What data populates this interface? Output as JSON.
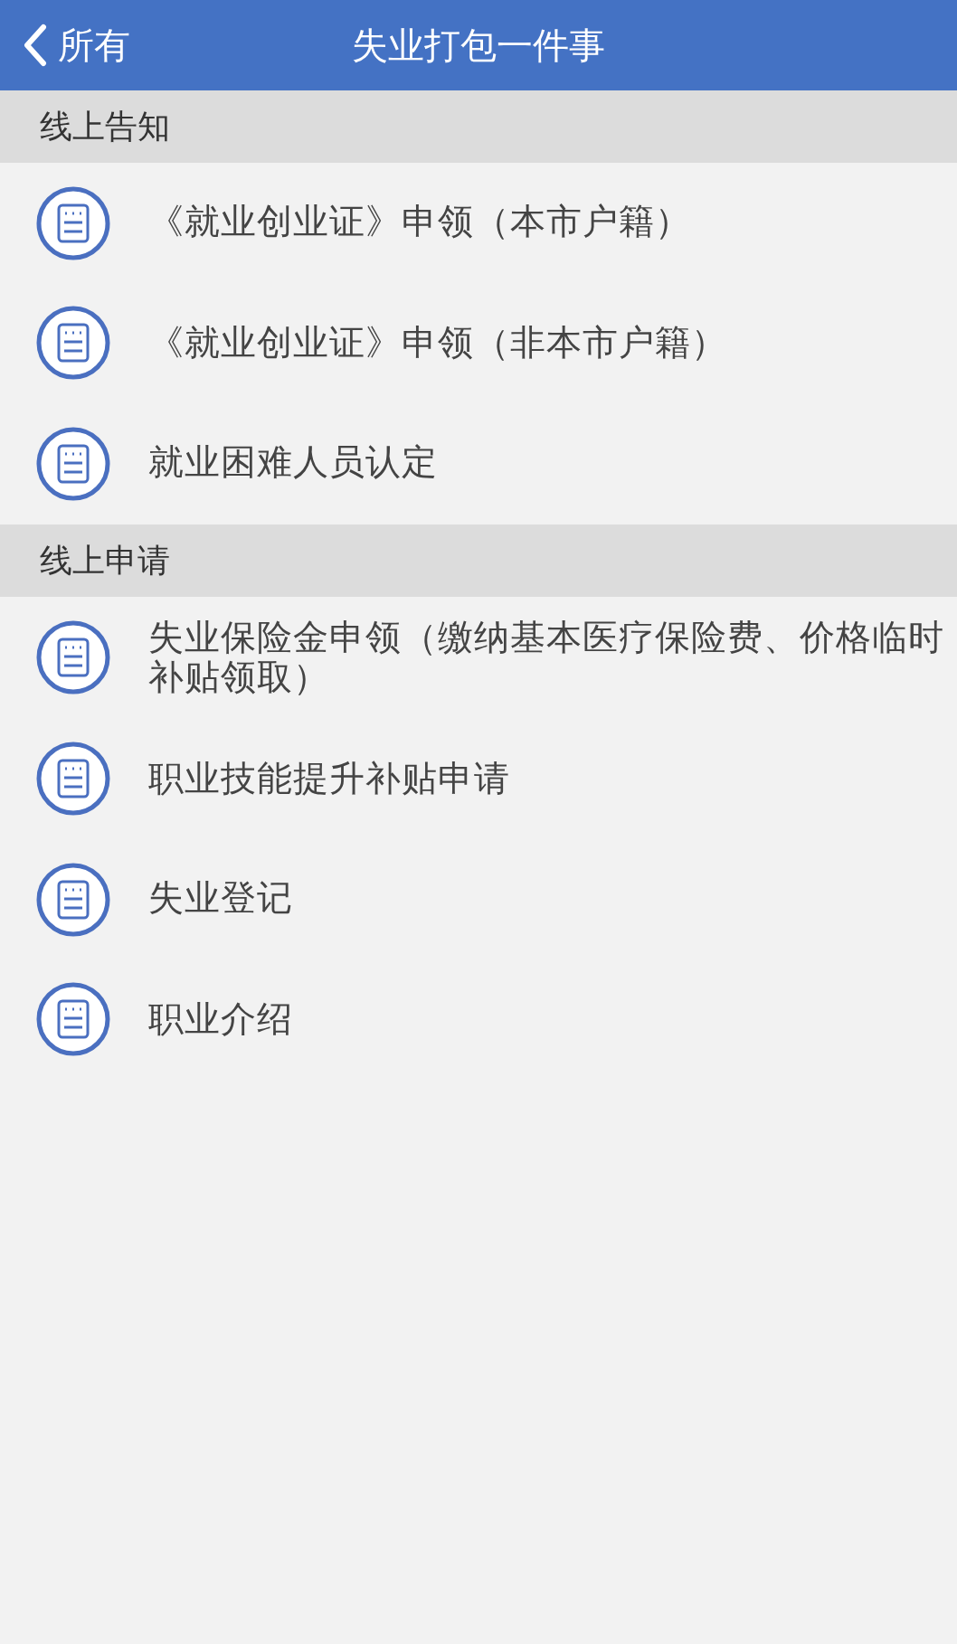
{
  "nav_bar": {
    "back_label": "所有",
    "title": "失业打包一件事"
  },
  "sections": [
    {
      "title": "线上告知",
      "items": [
        {
          "label": "《就业创业证》申领（本市户籍）"
        },
        {
          "label": "《就业创业证》申领（非本市户籍）"
        },
        {
          "label": "就业困难人员认定"
        }
      ]
    },
    {
      "title": "线上申请",
      "items": [
        {
          "label": "失业保险金申领（缴纳基本医疗保险费、价格临时补贴领取）"
        },
        {
          "label": "职业技能提升补贴申请"
        },
        {
          "label": "失业登记"
        },
        {
          "label": "职业介绍"
        }
      ]
    }
  ]
}
